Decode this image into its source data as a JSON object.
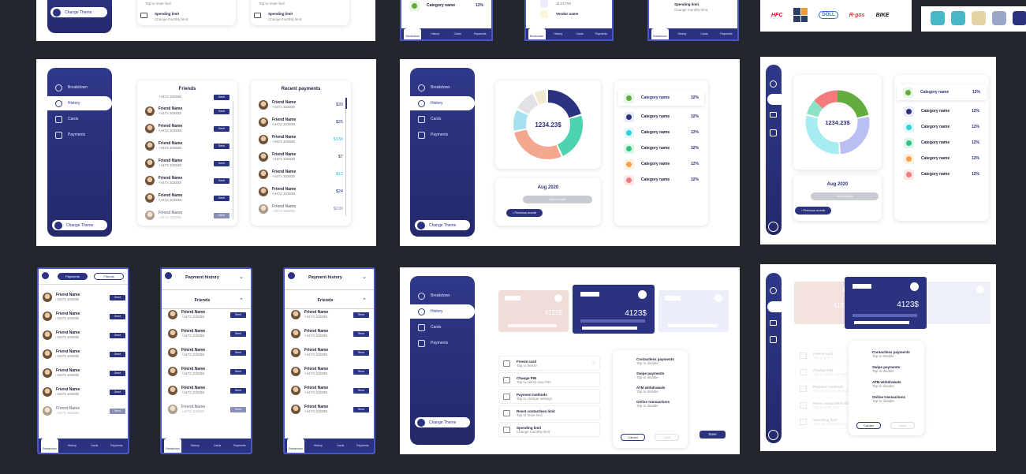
{
  "sidebar": {
    "items": [
      "Breakdown",
      "History",
      "Cards",
      "Payments"
    ],
    "change_theme": "Change Theme"
  },
  "bottom_nav": [
    "Breakdown",
    "History",
    "Cards",
    "Payments"
  ],
  "friends": {
    "title": "Friends",
    "name": "Friend Name",
    "phone": "+4473 102938",
    "send": "Send"
  },
  "recent": {
    "title": "Recent payments",
    "amounts": [
      "$30",
      "$25",
      "$130",
      "$7",
      "$12",
      "$24",
      "$230"
    ]
  },
  "breakdown": {
    "total": "1234.23$",
    "month": "Aug 2020",
    "next_month": "Next month",
    "prev_month": "Previous month",
    "category": "Category name",
    "pct": "12%",
    "colors": [
      "#62ad3e",
      "#2b3380",
      "#2fd3e0",
      "#31c47e",
      "#f2a14a",
      "#f27b7b"
    ]
  },
  "top_strip": {
    "category": "Category name",
    "vendor": "Vendor name",
    "pct": "12%",
    "time": "11:22 PM",
    "reset_limit_sub": "Tap to reset limit",
    "spending_limit": "Spending limit",
    "spending_limit_sub": "Change monthly limit"
  },
  "logos": [
    "HFC",
    "DOLL",
    "R·gos",
    "BIKE"
  ],
  "mobile": {
    "tab_a": "Payments",
    "tab_b": "Friends",
    "payment_history": "Payment history",
    "friends": "Friends"
  },
  "cards": {
    "balance": "4123$",
    "options": [
      {
        "title": "Freeze card",
        "sub": "Tap to freeze"
      },
      {
        "title": "Change PIN",
        "sub": "Tap to select new PIN"
      },
      {
        "title": "Payment methods",
        "sub": "Tap to change settings"
      },
      {
        "title": "Reset contactless limit",
        "sub": "Tap to reset limit"
      },
      {
        "title": "Spending limit",
        "sub": "Change monthly limit"
      }
    ],
    "modal": [
      {
        "title": "Contactless payments",
        "sub": "Tap to disable"
      },
      {
        "title": "Swipe payments",
        "sub": "Tap to disable"
      },
      {
        "title": "ATM withdrawals",
        "sub": "Tap to disable"
      },
      {
        "title": "Online transactions",
        "sub": "Tap to disable"
      }
    ],
    "cancel": "Cancel",
    "save": "Save"
  }
}
